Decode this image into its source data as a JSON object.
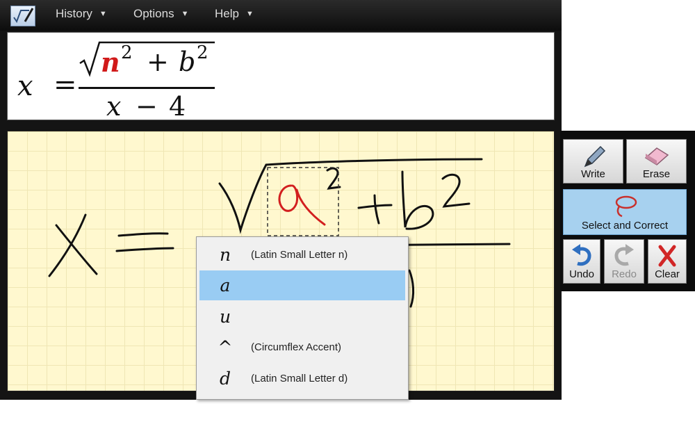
{
  "menubar": {
    "items": [
      {
        "label": "History"
      },
      {
        "label": "Options"
      },
      {
        "label": "Help"
      }
    ]
  },
  "preview": {
    "lhs": "x",
    "equals": "=",
    "numerator": {
      "var1": "n",
      "exp1": "2",
      "plus": "+",
      "var2": "b",
      "exp2": "2"
    },
    "denominator": {
      "var": "x",
      "minus": "−",
      "num": "4"
    },
    "highlight_color": "#d11a1a"
  },
  "tools": {
    "write": "Write",
    "erase": "Erase",
    "select_correct": "Select and Correct",
    "undo": "Undo",
    "redo": "Redo",
    "clear": "Clear"
  },
  "candidates": [
    {
      "glyph": "n",
      "desc": "(Latin Small Letter n)"
    },
    {
      "glyph": "a",
      "desc": ""
    },
    {
      "glyph": "u",
      "desc": ""
    },
    {
      "glyph": "^",
      "desc": "(Circumflex Accent)"
    },
    {
      "glyph": "d",
      "desc": "(Latin Small Letter d)"
    }
  ],
  "colors": {
    "ink": "#111111",
    "selected_ink": "#d21f1f",
    "pad_background": "#fff8cf",
    "selection_highlight": "#99ccf3",
    "active_tool": "#a7d1ef"
  }
}
